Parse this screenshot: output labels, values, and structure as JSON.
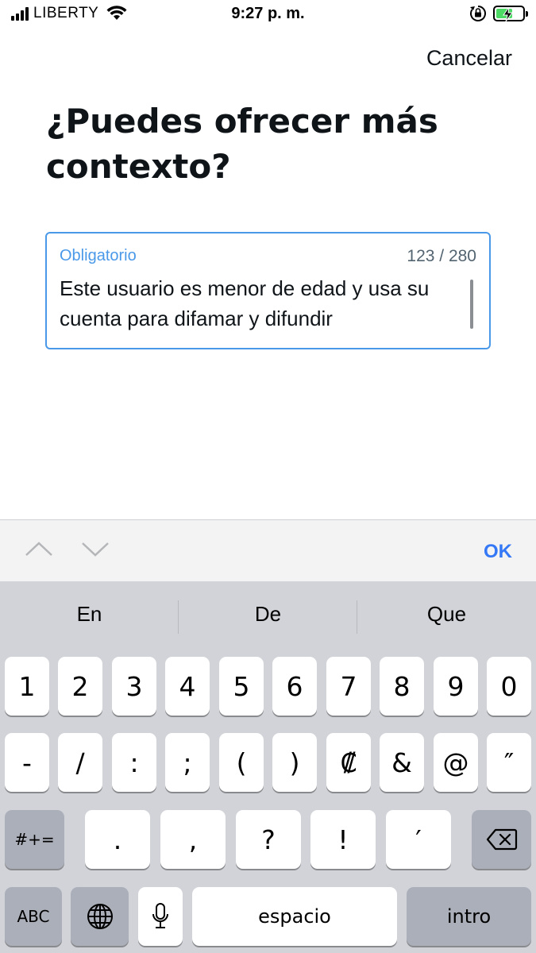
{
  "status_bar": {
    "carrier": "LIBERTY",
    "time": "9:27 p. m."
  },
  "header": {
    "cancel_label": "Cancelar",
    "title": "¿Puedes ofrecer más contexto?"
  },
  "text_field": {
    "label": "Obligatorio",
    "counter": "123 / 280",
    "value": "Este usuario es menor de edad y usa su cuenta para difamar y difundir"
  },
  "accessory_bar": {
    "ok_label": "OK"
  },
  "keyboard": {
    "suggestions": [
      "En",
      "De",
      "Que"
    ],
    "row1": [
      "1",
      "2",
      "3",
      "4",
      "5",
      "6",
      "7",
      "8",
      "9",
      "0"
    ],
    "row2": [
      "-",
      "/",
      ":",
      ";",
      "(",
      ")",
      "₡",
      "&",
      "@",
      "″"
    ],
    "row3": [
      ".",
      ",",
      "?",
      "!",
      "′"
    ],
    "symbols_label": "#+=",
    "abc_label": "ABC",
    "space_label": "espacio",
    "return_label": "intro"
  },
  "colors": {
    "accent": "#4a99e9",
    "ok_blue": "#3478f6",
    "keyboard_bg": "#d1d3d9",
    "battery_green": "#4cd964"
  }
}
